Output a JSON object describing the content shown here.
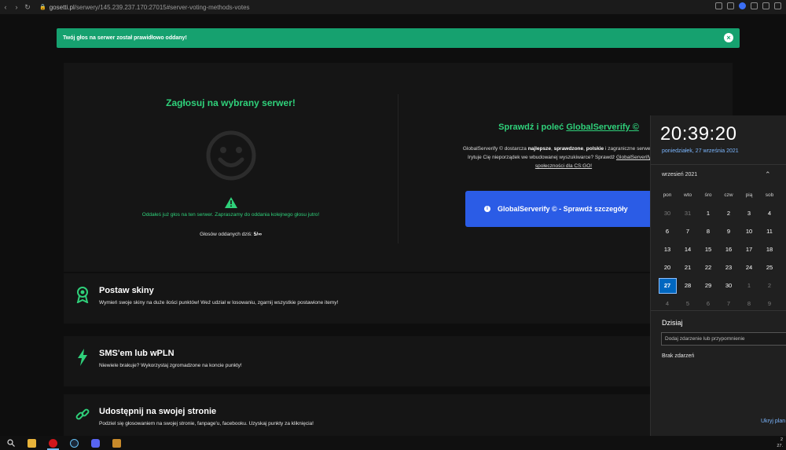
{
  "browser": {
    "url_domain": "gosetti.pl",
    "url_path": "/serwery/145.239.237.170:27015#server-voting-methods-votes"
  },
  "alert": {
    "text": "Twój głos na serwer został prawidłowo oddany!"
  },
  "vote": {
    "title": "Zagłosuj na wybrany serwer!",
    "voted_message": "Oddałeś już głos na ten serwer. Zapraszamy do oddania kolejnego głosu jutro!",
    "votes_today_label": "Głosów oddanych dziś:",
    "votes_today_value": "5/∞"
  },
  "globalserverify": {
    "title_prefix": "Sprawdź i poleć",
    "title_link": "GlobalServerify ©",
    "desc_1": "GlobalServerify © dostarcza ",
    "desc_bold_1": "najlepsze",
    "desc_2": ", ",
    "desc_bold_2": "sprawdzone",
    "desc_3": ", ",
    "desc_bold_3": "polskie",
    "desc_4": " i zagraniczne serwery bez",
    "desc_line2_a": "Irytuje Cię nieporządek we wbudowanej wyszukiwarce? Sprawdź ",
    "desc_line2_link": "GlobalServerify © -",
    "desc_line3_link": "społeczności dla CS:GO!",
    "button_label": "GlobalServerify © - Sprawdź szczegóły"
  },
  "cards": [
    {
      "title": "Postaw skiny",
      "desc": "Wymień swoje skiny na duże ilości punktów! Weź udział w losowaniu, zgarnij wszystkie postawione itemy!",
      "icon": "award-icon"
    },
    {
      "title": "SMS'em lub wPLN",
      "desc": "Niewiele brakuje? Wykorzystaj zgromadzone na koncie punkty!",
      "icon": "lightning-icon"
    },
    {
      "title": "Udostępnij na swojej stronie",
      "desc": "Podziel się głosowaniem na swojej stronie, fanpage'u, facebooku. Uzyskaj punkty za kliknięcia!",
      "icon": "link-icon"
    }
  ],
  "clock": {
    "time": "20:39:20",
    "date": "poniedziałek, 27 września 2021",
    "month": "wrzesień 2021",
    "weekdays": [
      "pon",
      "wto",
      "śro",
      "czw",
      "pią",
      "sob"
    ],
    "weeks": [
      [
        "30",
        "31",
        "1",
        "2",
        "3",
        "4"
      ],
      [
        "6",
        "7",
        "8",
        "9",
        "10",
        "11"
      ],
      [
        "13",
        "14",
        "15",
        "16",
        "17",
        "18"
      ],
      [
        "20",
        "21",
        "22",
        "23",
        "24",
        "25"
      ],
      [
        "27",
        "28",
        "29",
        "30",
        "1",
        "2"
      ],
      [
        "4",
        "5",
        "6",
        "7",
        "8",
        "9"
      ]
    ],
    "today_label": "Dzisiaj",
    "event_placeholder": "Dodaj zdarzenie lub przypomnienie",
    "no_events": "Brak zdarzeń",
    "hide_plan": "Ukryj plan"
  },
  "colors": {
    "accent_green": "#2fd07a",
    "alert_green": "#16a16f",
    "button_blue": "#2b5ce6",
    "today_blue": "#0067c0"
  },
  "taskbar": {
    "icons": [
      "search-icon",
      "file-explorer-icon",
      "opera-icon",
      "steam-icon",
      "discord-icon",
      "csgo-icon"
    ],
    "tray_time_partial": "2",
    "tray_date_partial": "27."
  }
}
